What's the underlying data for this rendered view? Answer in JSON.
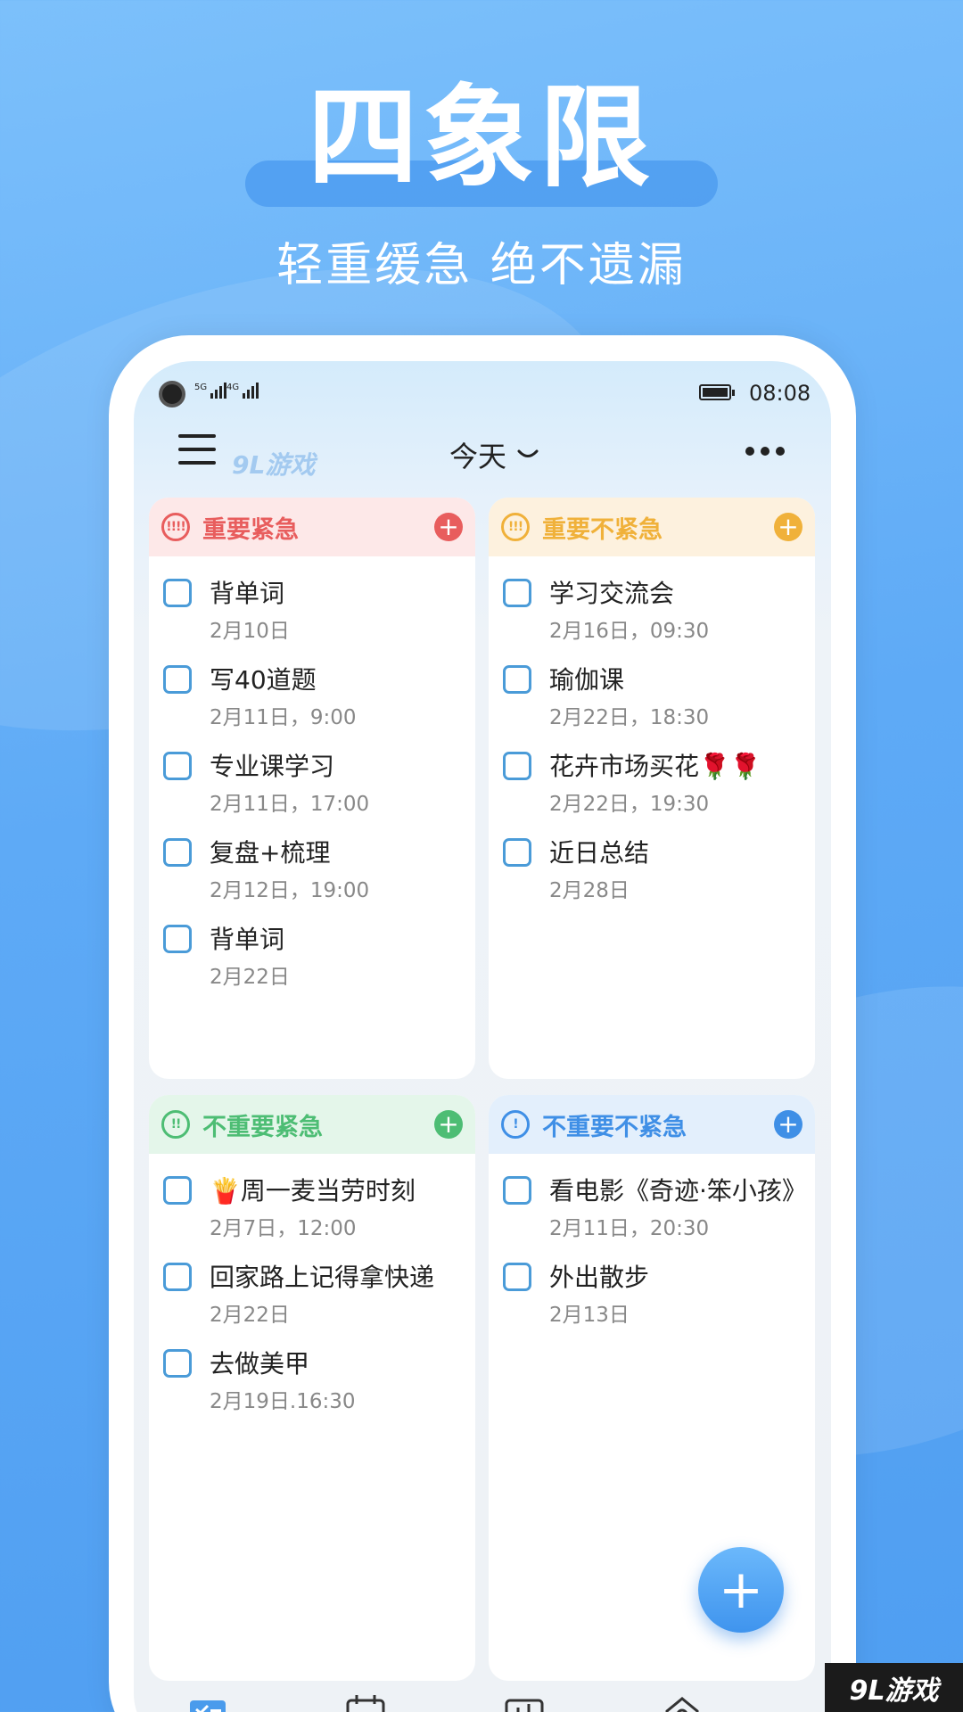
{
  "promo": {
    "title": "四象限",
    "subtitle": "轻重缓急 绝不遗漏"
  },
  "status_bar": {
    "network1": "5G",
    "network2": "4G",
    "time": "08:08"
  },
  "toolbar": {
    "view_label": "今天",
    "menu_icon": "hamburger-menu-icon",
    "more_icon": "more-dots-icon",
    "watermark": "9L游戏"
  },
  "quadrants": [
    {
      "title": "重要紧急",
      "color": "#e85d5d",
      "head_bg": "#fde8e8",
      "icon_text": "!!!!",
      "tasks": [
        {
          "title": "背单词",
          "date": "2月10日"
        },
        {
          "title": "写40道题",
          "date": "2月11日，9:00"
        },
        {
          "title": "专业课学习",
          "date": "2月11日，17:00"
        },
        {
          "title": "复盘+梳理",
          "date": "2月12日，19:00"
        },
        {
          "title": "背单词",
          "date": "2月22日"
        }
      ]
    },
    {
      "title": "重要不紧急",
      "color": "#f0b13a",
      "head_bg": "#fdf1de",
      "icon_text": "!!!",
      "tasks": [
        {
          "title": "学习交流会",
          "date": "2月16日，09:30"
        },
        {
          "title": "瑜伽课",
          "date": "2月22日，18:30"
        },
        {
          "title": "花卉市场买花🌹🌹",
          "date": "2月22日，19:30"
        },
        {
          "title": "近日总结",
          "date": "2月28日"
        }
      ]
    },
    {
      "title": "不重要紧急",
      "color": "#4dbd74",
      "head_bg": "#e4f6ea",
      "icon_text": "!!",
      "tasks": [
        {
          "title": "🍟周一麦当劳时刻",
          "date": "2月7日，12:00"
        },
        {
          "title": "回家路上记得拿快递",
          "date": "2月22日"
        },
        {
          "title": "去做美甲",
          "date": "2月19日.16:30"
        }
      ]
    },
    {
      "title": "不重要不紧急",
      "color": "#3f8fe6",
      "head_bg": "#e3effc",
      "icon_text": "!",
      "tasks": [
        {
          "title": "看电影《奇迹·笨小孩》",
          "date": "2月11日，20:30"
        },
        {
          "title": "外出散步",
          "date": "2月13日"
        }
      ]
    }
  ],
  "fab_label": "+",
  "corner_watermark": "9L游戏"
}
